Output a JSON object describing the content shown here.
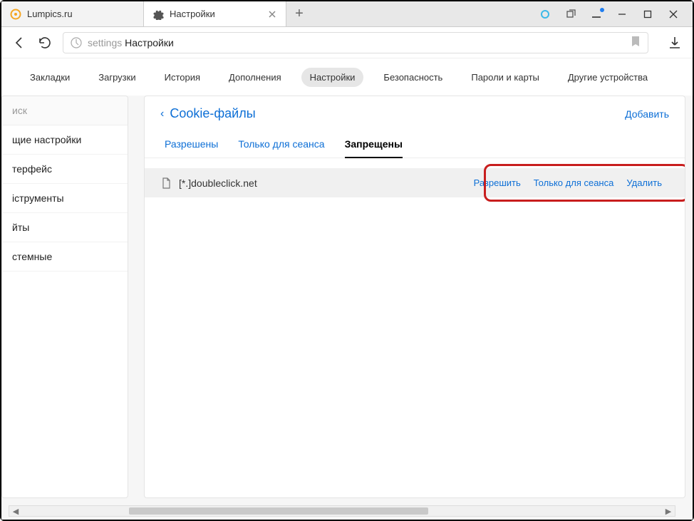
{
  "tabs": [
    {
      "title": "Lumpics.ru"
    },
    {
      "title": "Настройки"
    }
  ],
  "address": {
    "prefix": "settings",
    "title": "Настройки"
  },
  "top_nav": [
    "Закладки",
    "Загрузки",
    "История",
    "Дополнения",
    "Настройки",
    "Безопасность",
    "Пароли и карты",
    "Другие устройства"
  ],
  "top_nav_active": 4,
  "sidebar": {
    "search": "иск",
    "items": [
      "щие настройки",
      "терфейс",
      "іструменты",
      "йты",
      "стемные"
    ]
  },
  "panel": {
    "title": "Cookie-файлы",
    "add": "Добавить",
    "subtabs": [
      "Разрешены",
      "Только для сеанса",
      "Запрещены"
    ],
    "subtab_active": 2,
    "rows": [
      {
        "site": "[*.]doubleclick.net",
        "actions": [
          "Разрешить",
          "Только для сеанса",
          "Удалить"
        ]
      }
    ]
  }
}
